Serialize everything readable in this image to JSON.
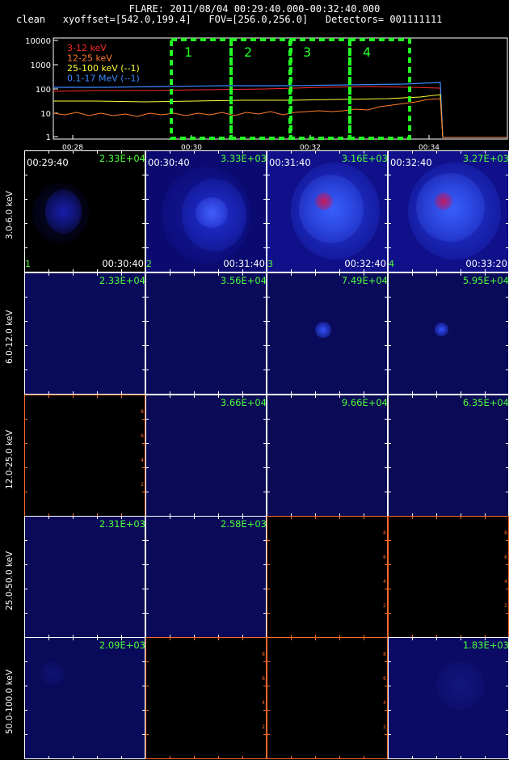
{
  "header": {
    "line1": "FLARE: 2011/08/04 00:29:40.000-00:32:40.000",
    "line2": "clean   xyoffset=[542.0,199.4]   FOV=[256.0,256.0]   Detectors= 001111111"
  },
  "lightcurve": {
    "legend": [
      {
        "label": "3-12 keV",
        "color": "#ff2a2a"
      },
      {
        "label": "12-25 keV",
        "color": "#ff7a2a"
      },
      {
        "label": "25-100 keV (--1)",
        "color": "#ffff3a"
      },
      {
        "label": "0.1-17 MeV (--1)",
        "color": "#3a8aff"
      }
    ],
    "y_ticks": [
      "10000",
      "1000",
      "100",
      "10",
      "1"
    ],
    "x_ticks": [
      "00:28",
      "00:30",
      "00:32",
      "00:34"
    ],
    "interval_labels": [
      "1",
      "2",
      "3",
      "4"
    ],
    "interval_color": "#22ff22"
  },
  "energy_bands": [
    "3.0-6.0 keV",
    "6.0-12.0 keV",
    "12.0-25.0 keV",
    "25.0-50.0 keV",
    "50.0-100.0 keV"
  ],
  "image_panels": {
    "row0": [
      {
        "max": "2.33E+04",
        "start": "00:29:40",
        "end": "00:30:40",
        "index": "1"
      },
      {
        "max": "3.33E+03",
        "start": "00:30:40",
        "end": "00:31:40",
        "index": "2"
      },
      {
        "max": "3.16E+03",
        "start": "00:31:40",
        "end": "00:32:40",
        "index": "3"
      },
      {
        "max": "3.27E+03",
        "start": "00:32:40",
        "end": "00:33:20",
        "index": "4"
      }
    ],
    "row1": [
      "2.33E+04",
      "3.56E+04",
      "7.49E+04",
      "5.95E+04"
    ],
    "row2": [
      "",
      "3.66E+04",
      "9.66E+04",
      "6.35E+04"
    ],
    "row3": [
      "2.31E+03",
      "2.58E+03",
      "",
      ""
    ],
    "row4": [
      "2.09E+03",
      "",
      "",
      "1.83E+03"
    ]
  },
  "empty_axis_numbers": [
    "2",
    "4",
    "6",
    "8"
  ]
}
